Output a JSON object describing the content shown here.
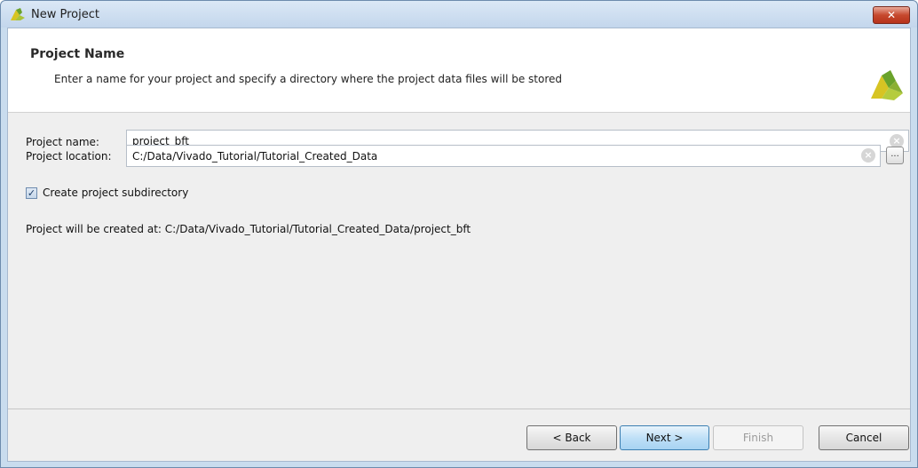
{
  "window": {
    "title": "New Project",
    "close_glyph": "✕"
  },
  "header": {
    "title": "Project Name",
    "subtitle": "Enter a name for your project and specify a directory where the project data files will be stored",
    "logo_icon": "vivado-logo-icon"
  },
  "form": {
    "name_label": "Project name:",
    "name_value": "project_bft",
    "location_label": "Project location:",
    "location_value": "C:/Data/Vivado_Tutorial/Tutorial_Created_Data",
    "browse_label": "...",
    "subdir_checked": true,
    "subdir_label": "Create project subdirectory",
    "created_at": "Project will be created at: C:/Data/Vivado_Tutorial/Tutorial_Created_Data/project_bft"
  },
  "buttons": {
    "back": "< Back",
    "next": "Next >",
    "finish": "Finish",
    "cancel": "Cancel"
  },
  "colors": {
    "accent": "#3c7fb1",
    "logo_yellow": "#d7c423",
    "logo_green": "#6aa22a"
  }
}
